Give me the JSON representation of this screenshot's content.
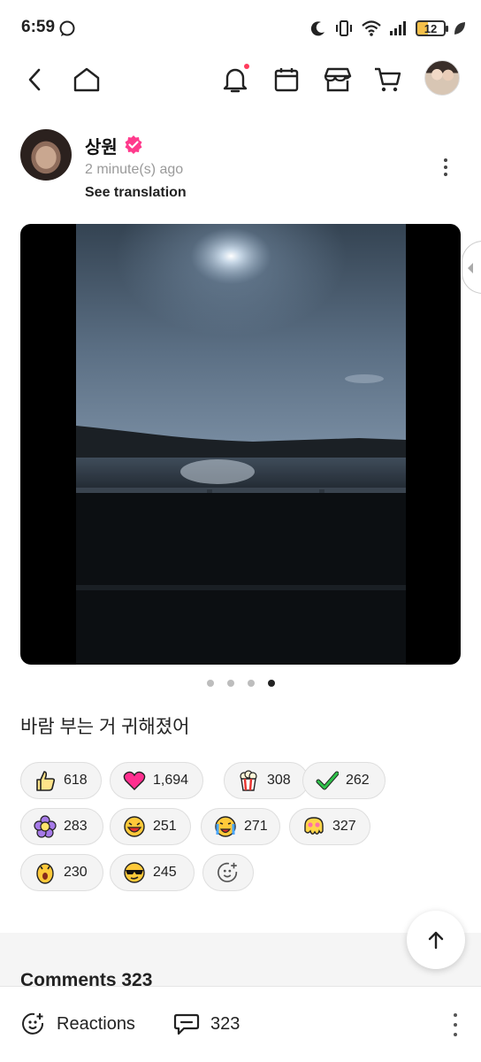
{
  "status_bar": {
    "time": "6:59",
    "battery": "12",
    "icons": [
      "chat-bubble-icon",
      "moon-icon",
      "vibrate-icon",
      "wifi-icon",
      "signal-icon",
      "leaf-icon"
    ]
  },
  "nav": {
    "icons": [
      "back-icon",
      "home-icon",
      "bell-icon",
      "calendar-icon",
      "shop-icon",
      "cart-icon"
    ]
  },
  "post": {
    "author": "상원",
    "time": "2 minute(s) ago",
    "see_translation": "See translation",
    "caption": "바람 부는 거 귀해졌어",
    "page_count": 4,
    "active_page": 4
  },
  "reactions": [
    {
      "icon": "thumbs-up-icon",
      "count": "618"
    },
    {
      "icon": "heart-icon",
      "count": "1,694"
    },
    {
      "icon": "popcorn-icon",
      "count": "308"
    },
    {
      "icon": "check-icon",
      "count": "262"
    },
    {
      "icon": "flower-icon",
      "count": "283"
    },
    {
      "icon": "laughing-icon",
      "count": "251"
    },
    {
      "icon": "crying-icon",
      "count": "271"
    },
    {
      "icon": "melting-icon",
      "count": "327"
    },
    {
      "icon": "surprised-icon",
      "count": "230"
    },
    {
      "icon": "cool-icon",
      "count": "245"
    }
  ],
  "comments": {
    "title": "Comments 323"
  },
  "bottom_bar": {
    "reactions_label": "Reactions",
    "comments_count": "323"
  },
  "colors": {
    "verified": "#ff3a8c",
    "notification_dot": "#ff3b5c",
    "chip_background": "#f4f4f4"
  }
}
